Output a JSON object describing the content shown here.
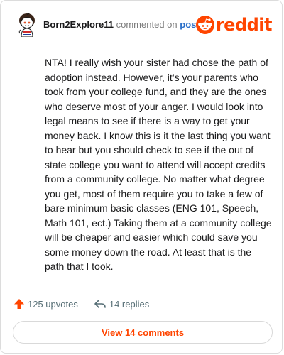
{
  "header": {
    "username": "Born2Explore11",
    "action_text": "commented on",
    "post_link_label": "post"
  },
  "brand": {
    "wordmark": "reddit",
    "color": "#ff4500"
  },
  "comment": {
    "body": "NTA! I really wish your sister had chose the path of adoption instead. However, it’s your parents who took from your college fund, and they are the ones who deserve most of your anger. I would look into legal means to see if there is a way to get your money back. I know this is it the last thing you want to hear but you should check to see if the out of state college you want to attend will accept credits from a community college. No matter what degree you get, most of them require you to take a few of bare minimum basic classes (ENG 101, Speech, Math 101, ect.) Taking them at a community college will be cheaper and easier which could save you some money down the road. At least that is the path that I took."
  },
  "stats": {
    "upvotes": "125 upvotes",
    "replies": "14 replies"
  },
  "footer": {
    "view_comments_label": "View 14 comments"
  },
  "icons": {
    "avatar": "snoo-avatar-icon",
    "logo": "reddit-logo-icon",
    "upvote": "upvote-arrow-icon",
    "reply": "reply-arrow-icon"
  },
  "colors": {
    "accent": "#ff4500",
    "link": "#2a6fc9",
    "muted": "#7c7c7c"
  }
}
